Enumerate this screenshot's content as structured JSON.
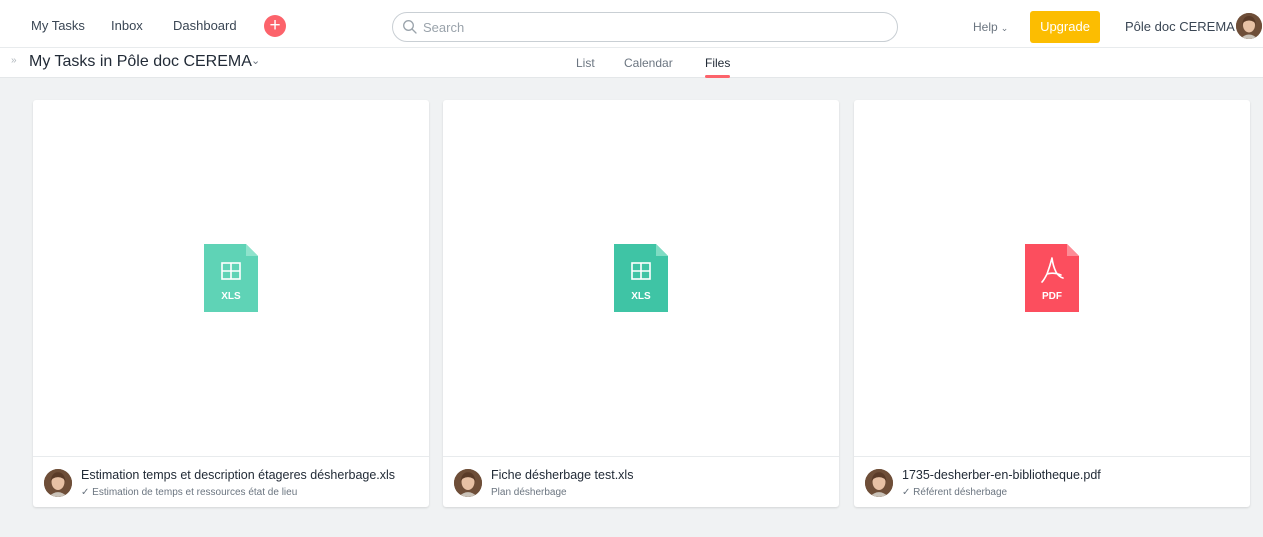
{
  "topbar": {
    "nav": [
      "My Tasks",
      "Inbox",
      "Dashboard"
    ],
    "search_placeholder": "Search",
    "help_label": "Help",
    "upgrade_label": "Upgrade",
    "workspace_name": "Pôle doc CEREMA"
  },
  "header": {
    "title": "My Tasks in Pôle doc CEREMA",
    "tabs": [
      "List",
      "Calendar",
      "Files"
    ],
    "active_tab": "Files"
  },
  "colors": {
    "accent": "#fc636b",
    "upgrade": "#fcbd01",
    "xls": "#50d0b0",
    "pdf": "#fc4e5e"
  },
  "files": [
    {
      "name": "Estimation temps et description étageres désherbage.xls",
      "task": "✓ Estimation de temps et ressources état de lieu",
      "type": "XLS",
      "icon": "spreadsheet-icon"
    },
    {
      "name": "Fiche désherbage test.xls",
      "task": "Plan désherbage",
      "type": "XLS",
      "icon": "spreadsheet-icon"
    },
    {
      "name": "1735-desherber-en-bibliotheque.pdf",
      "task": "✓ Référent désherbage",
      "type": "PDF",
      "icon": "pdf-icon"
    }
  ]
}
